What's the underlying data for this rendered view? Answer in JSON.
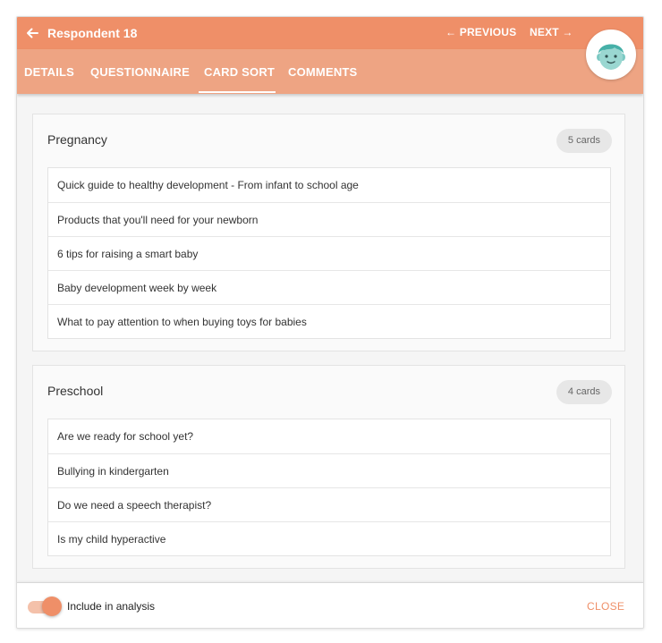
{
  "header": {
    "title": "Respondent 18",
    "prev_label": "← PREVIOUS",
    "next_label": "NEXT →",
    "accent_color": "#ef8f68",
    "tab_bar_color": "#eea483"
  },
  "tabs": [
    {
      "label": "DETAILS",
      "active": false
    },
    {
      "label": "QUESTIONNAIRE",
      "active": false
    },
    {
      "label": "CARD SORT",
      "active": true
    },
    {
      "label": "COMMENTS",
      "active": false
    }
  ],
  "groups": [
    {
      "title": "Pregnancy",
      "count_label": "5 cards",
      "cards": [
        "Quick guide to healthy development - From infant to school age",
        "Products that you'll need for your newborn",
        "6 tips for raising a smart baby",
        "Baby development week by week",
        "What to pay attention to when buying toys for babies"
      ]
    },
    {
      "title": "Preschool",
      "count_label": "4 cards",
      "cards": [
        "Are we ready for school yet?",
        "Bullying in kindergarten",
        "Do we need a speech therapist?",
        "Is my child hyperactive"
      ]
    }
  ],
  "footer": {
    "toggle_label": "Include in analysis",
    "toggle_on": true,
    "close_label": "CLOSE"
  },
  "icons": {
    "back": "arrow-left-icon",
    "avatar": "boy-avatar"
  }
}
